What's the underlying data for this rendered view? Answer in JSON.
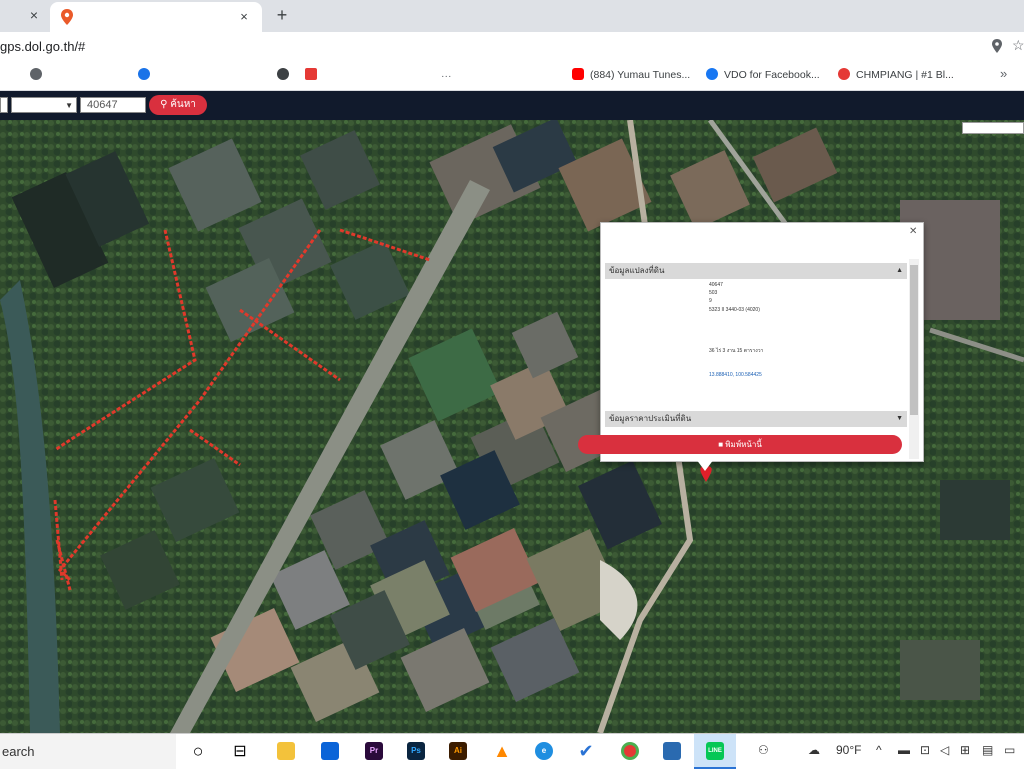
{
  "browser": {
    "tab_prev_close": "×",
    "active_tab_title": "",
    "tab_close": "×",
    "new_tab": "+",
    "url": "gps.dol.go.th/#",
    "bookmarks": [
      {
        "label": "",
        "icon": "globe-icon",
        "color": "#5f6368"
      },
      {
        "label": "",
        "icon": "globe-icon",
        "color": "#1a73e8"
      },
      {
        "label": "",
        "icon": "globe-icon",
        "color": "#5f6368"
      },
      {
        "label": "",
        "icon": "bookmark-icon",
        "color": "#e53935"
      },
      {
        "label": "",
        "icon": "dots-icon",
        "color": "#5f6368"
      },
      {
        "label": "(884) Yumau Tunes...",
        "icon": "youtube-icon",
        "color": "#ff0000"
      },
      {
        "label": "VDO for Facebook...",
        "icon": "facebook-icon",
        "color": "#1877f2"
      },
      {
        "label": "CHMPIANG | #1 Bl...",
        "icon": "site-icon",
        "color": "#e53935"
      }
    ],
    "more_bookmarks": "»"
  },
  "app_toolbar": {
    "province_select": "",
    "district_select": "",
    "parcel_number": "40647",
    "search_button": "ค้นหา"
  },
  "map": {
    "layer_label": "",
    "boundary_color": "#e0392b",
    "marker_color": "#e0202a"
  },
  "popup": {
    "close": "✕",
    "warning": "",
    "section1_header": "ข้อมูลแปลงที่ดิน",
    "section2_header": "ข้อมูลราคาประเมินที่ดิน",
    "rows": [
      {
        "key": "",
        "value": "40647"
      },
      {
        "key": "",
        "value": "503"
      },
      {
        "key": "",
        "value": "9"
      },
      {
        "key": "",
        "value": "5323 II 3440-03 (4020)"
      },
      {
        "key": "",
        "value": ""
      },
      {
        "key": "",
        "value": ""
      },
      {
        "key": "",
        "value": ""
      },
      {
        "key": "",
        "value": ""
      },
      {
        "key": "",
        "value": "36 ไร่ 3 งาน 15 ตารางวา"
      },
      {
        "key": "",
        "value": ""
      },
      {
        "key": "",
        "value": ""
      },
      {
        "key": "",
        "value": "13.888410, 100.584425"
      },
      {
        "key": "",
        "value": ""
      },
      {
        "key": "",
        "value": ""
      }
    ],
    "print_button": "พิมพ์หน้านี้"
  },
  "taskbar": {
    "search_text": "earch",
    "weather": "90°F",
    "apps": [
      {
        "name": "cortana",
        "label": "○",
        "color": "#ffffff"
      },
      {
        "name": "task-view",
        "label": "⊟",
        "color": "#ffffff"
      },
      {
        "name": "file-explorer",
        "label": "",
        "color": "#f3c23b"
      },
      {
        "name": "mail",
        "label": "",
        "color": "#0a64d8"
      },
      {
        "name": "premiere",
        "label": "Pr",
        "color": "#2a0a3b"
      },
      {
        "name": "photoshop",
        "label": "Ps",
        "color": "#0a2540"
      },
      {
        "name": "illustrator",
        "label": "Ai",
        "color": "#3b1c00"
      },
      {
        "name": "vlc",
        "label": "▲",
        "color": "#ff8800"
      },
      {
        "name": "edge",
        "label": "e",
        "color": "#1f8ee0"
      },
      {
        "name": "todo",
        "label": "✔",
        "color": "#2a73d4"
      },
      {
        "name": "chrome",
        "label": "",
        "color": "#e53935"
      },
      {
        "name": "photos",
        "label": "",
        "color": "#2a6ab0"
      },
      {
        "name": "line",
        "label": "LINE",
        "color": "#06c755"
      }
    ]
  }
}
